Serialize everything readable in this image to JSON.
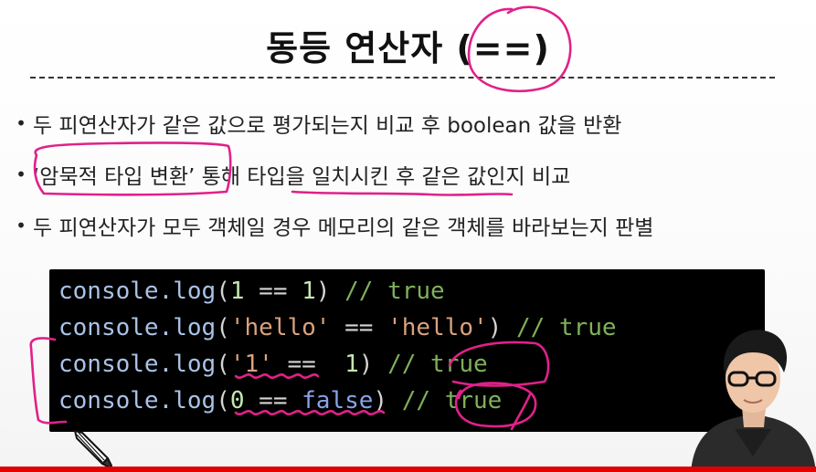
{
  "slide": {
    "title": "동등 연산자 (==)",
    "bullets": [
      {
        "text": "두 피연산자가 같은 값으로 평가되는지 비교 후 boolean 값을 반환"
      },
      {
        "text": "‘암묵적 타입 변환’ 통해 타입을 일치시킨 후 같은 값인지 비교"
      },
      {
        "text": "두 피연산자가 모두 객체일 경우 메모리의 같은 객체를 바라보는지 판별"
      }
    ],
    "code": [
      {
        "fn": "console.",
        "fn2": "log",
        "open": "(",
        "a": "1",
        "op": " == ",
        "b": "1",
        "close": ")",
        "comment": " // true"
      },
      {
        "fn": "console.",
        "fn2": "log",
        "open": "(",
        "a": "'hello'",
        "op": " == ",
        "b": "'hello'",
        "close": ")",
        "comment": " // true"
      },
      {
        "fn": "console.",
        "fn2": "log",
        "open": "(",
        "a": "'1'",
        "op": " ==  ",
        "b": "1",
        "close": ")",
        "comment": " // true"
      },
      {
        "fn": "console.",
        "fn2": "log",
        "open": "(",
        "a": "0",
        "op": " == ",
        "b": "false",
        "close": ")",
        "comment": " // true"
      }
    ]
  },
  "player": {
    "progress": 1.0
  },
  "colors": {
    "annotation": "#e0218a",
    "progress": "#e00000",
    "code_bg": "#000000"
  },
  "icons": {
    "pencil": "pencil-cursor-icon"
  }
}
